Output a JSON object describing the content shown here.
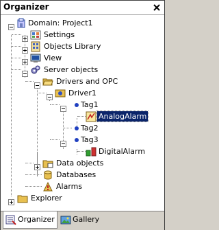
{
  "window": {
    "title": "Organizer"
  },
  "tree": {
    "root": "Domain: Project1",
    "settings": "Settings",
    "objects_library": "Objects Library",
    "view": "View",
    "server_objects": "Server objects",
    "drivers_and_opc": "Drivers and OPC",
    "driver1": "Driver1",
    "tag1": "Tag1",
    "analog_alarm": "AnalogAlarm",
    "tag2": "Tag2",
    "tag3": "Tag3",
    "digital_alarm": "DigitalAlarm",
    "data_objects": "Data objects",
    "databases": "Databases",
    "alarms": "Alarms",
    "explorer": "Explorer"
  },
  "tabs": {
    "organizer": "Organizer",
    "gallery": "Gallery"
  },
  "selected_item": "AnalogAlarm"
}
